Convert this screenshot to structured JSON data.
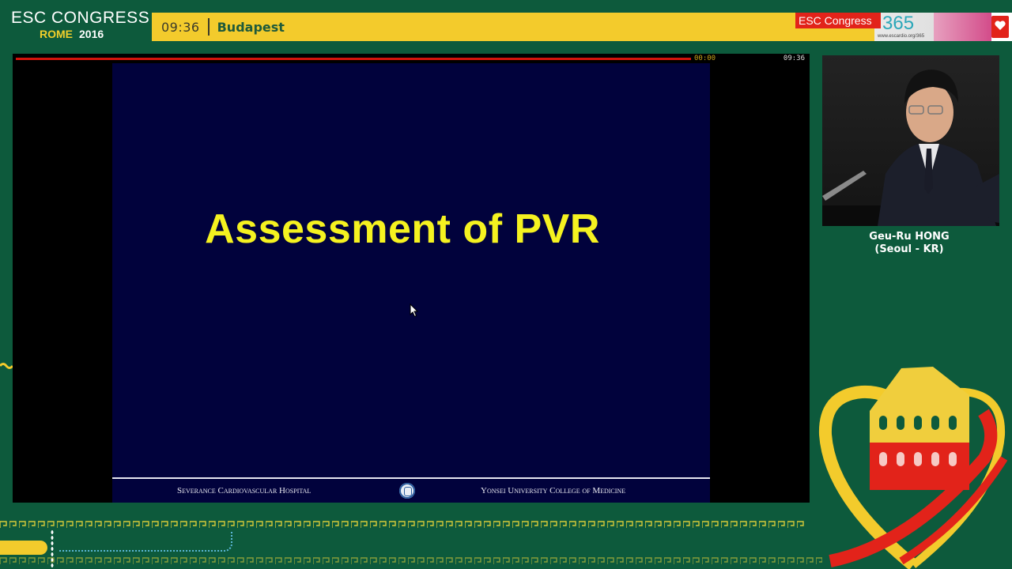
{
  "header": {
    "brand_line1": "ESC CONGRESS",
    "brand_city": "ROME",
    "brand_year": "2016",
    "time": "09:36",
    "room": "Budapest"
  },
  "esc365": {
    "label": "ESC Congress",
    "number": "365",
    "url": "www.escardio.org/365"
  },
  "player": {
    "time_start": "00:00",
    "time_end": "09:36",
    "progress": 1.0
  },
  "slide": {
    "title": "Assessment of PVR",
    "footer_left": "Severance Cardiovascular Hospital",
    "footer_right": "Yonsei University College of Medicine"
  },
  "speaker": {
    "name": "Geu-Ru HONG",
    "location": "(Seoul - KR)"
  },
  "colors": {
    "background": "#0d5a3c",
    "accent_yellow": "#f3cb2c",
    "slide_bg": "#01023c",
    "slide_title": "#f5f220",
    "progress": "#d3150c",
    "esc_red": "#e2231a"
  }
}
